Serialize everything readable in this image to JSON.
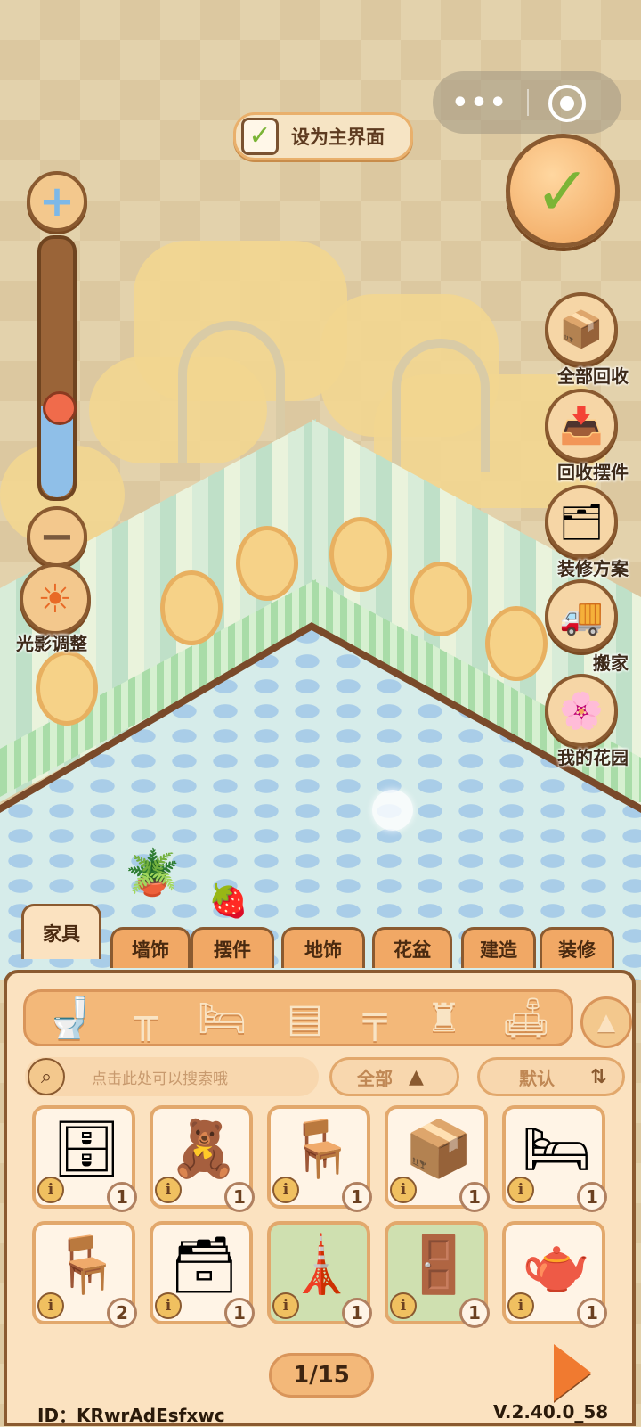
{
  "top_bar": {
    "more_glyph": "•••",
    "set_as_main_label": "设为主界面"
  },
  "left_controls": {
    "zoom_in_glyph": "+",
    "zoom_out_glyph": "−",
    "zoom_level": 0.35,
    "light_label": "光影调整"
  },
  "right_menu": [
    {
      "label": "全部回收",
      "icon": "box-recycle-icon",
      "glyph": "📦"
    },
    {
      "label": "回收摆件",
      "icon": "ornament-recycle-icon",
      "glyph": "📥"
    },
    {
      "label": "装修方案",
      "icon": "plan-cards-icon",
      "glyph": "🗂"
    },
    {
      "label": "搬家",
      "icon": "moving-truck-icon",
      "glyph": "🚚"
    },
    {
      "label": "我的花园",
      "icon": "garden-arch-icon",
      "glyph": "🌸"
    }
  ],
  "tabs": [
    {
      "label": "家具",
      "active": true
    },
    {
      "label": "墙饰",
      "active": false
    },
    {
      "label": "摆件",
      "active": false
    },
    {
      "label": "地饰",
      "active": false
    },
    {
      "label": "花盆",
      "active": false
    },
    {
      "label": "建造",
      "active": false
    },
    {
      "label": "装修",
      "active": false
    }
  ],
  "categories": [
    {
      "name": "toilet-icon",
      "glyph": "🚽"
    },
    {
      "name": "stool-icon",
      "glyph": "╥"
    },
    {
      "name": "bed-icon",
      "glyph": "🛏"
    },
    {
      "name": "cabinet-icon",
      "glyph": "▤"
    },
    {
      "name": "table-icon",
      "glyph": "╤"
    },
    {
      "name": "lamp-icon",
      "glyph": "♜"
    },
    {
      "name": "sofa-icon",
      "glyph": "🛋"
    }
  ],
  "search": {
    "placeholder": "点击此处可以搜索哦"
  },
  "filter": {
    "value": "全部"
  },
  "sort": {
    "value": "默认"
  },
  "items": [
    {
      "name": "wooden-stove",
      "glyph": "🗄",
      "count": "1",
      "green": false
    },
    {
      "name": "figurine-doll",
      "glyph": "🧸",
      "count": "1",
      "green": false
    },
    {
      "name": "folding-chair-blue",
      "glyph": "🪑",
      "count": "1",
      "green": false
    },
    {
      "name": "wooden-box-bed",
      "glyph": "📦",
      "count": "1",
      "green": false
    },
    {
      "name": "lace-table",
      "glyph": "🛏",
      "count": "1",
      "green": false
    },
    {
      "name": "folding-chair-blue-2",
      "glyph": "🪑",
      "count": "2",
      "green": false
    },
    {
      "name": "cloth-table",
      "glyph": "🗃",
      "count": "1",
      "green": false
    },
    {
      "name": "tall-pillar-cabinet",
      "glyph": "🗼",
      "count": "1",
      "green": true
    },
    {
      "name": "screen-panel",
      "glyph": "🚪",
      "count": "1",
      "green": true
    },
    {
      "name": "stove-kettle",
      "glyph": "🫖",
      "count": "1",
      "green": false
    }
  ],
  "pager": {
    "text": "1/15"
  },
  "footer": {
    "id": "ID：KRwrAdEsfxwc",
    "version": "V.2.40.0_58"
  }
}
